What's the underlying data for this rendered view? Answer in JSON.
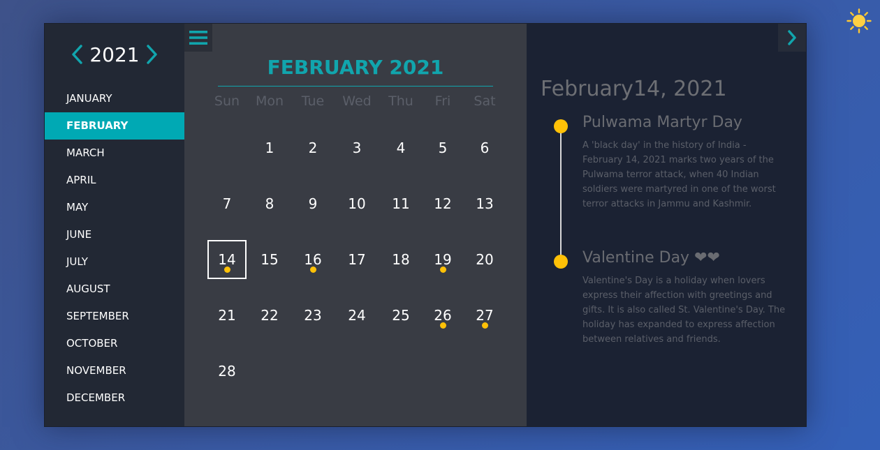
{
  "header": {
    "year": "2021",
    "prev_icon": "chevron-left-icon",
    "next_icon": "chevron-right-icon",
    "theme_icon": "sun-icon"
  },
  "sidebar": {
    "months": [
      "JANUARY",
      "FEBRUARY",
      "MARCH",
      "APRIL",
      "MAY",
      "JUNE",
      "JULY",
      "AUGUST",
      "SEPTEMBER",
      "OCTOBER",
      "NOVEMBER",
      "DECEMBER"
    ],
    "active_month": "FEBRUARY"
  },
  "calendar": {
    "title": "FEBRUARY 2021",
    "weekdays": [
      "Sun",
      "Mon",
      "Tue",
      "Wed",
      "Thu",
      "Fri",
      "Sat"
    ],
    "weeks": [
      [
        "",
        "1",
        "2",
        "3",
        "4",
        "5",
        "6"
      ],
      [
        "7",
        "8",
        "9",
        "10",
        "11",
        "12",
        "13"
      ],
      [
        "14",
        "15",
        "16",
        "17",
        "18",
        "19",
        "20"
      ],
      [
        "21",
        "22",
        "23",
        "24",
        "25",
        "26",
        "27"
      ],
      [
        "28",
        "",
        "",
        "",
        "",
        "",
        ""
      ]
    ],
    "selected_day": "14",
    "event_days": [
      "14",
      "16",
      "19",
      "26",
      "27"
    ],
    "accent_color": "#11a5ad",
    "dot_color": "#ffc107"
  },
  "events_panel": {
    "date_heading": "February14, 2021",
    "events": [
      {
        "title": "Pulwama Martyr Day",
        "description": "A 'black day' in the history of India - February 14, 2021 marks two years of the Pulwama terror attack, when 40 Indian soldiers were martyred in one of the worst terror attacks in Jammu and Kashmir."
      },
      {
        "title": "Valentine Day",
        "title_suffix": "❤❤",
        "description": "Valentine's Day is a holiday when lovers express their affection with greetings and gifts. It is also called St. Valentine's Day. The holiday has expanded to express affection between relatives and friends."
      }
    ]
  }
}
